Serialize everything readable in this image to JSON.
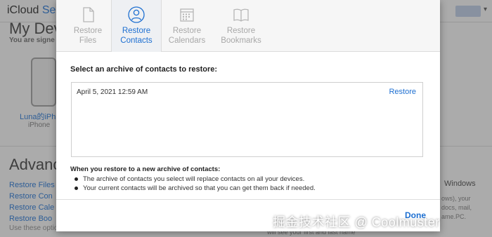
{
  "background": {
    "app_title": "iCloud",
    "app_title_accent": "Se",
    "heading_devices": "My Devi",
    "devices_subtitle": "You are signe",
    "device_name": "Luna的iPh",
    "device_model": "iPhone",
    "heading_advanced": "Advanc",
    "links": [
      "Restore Files",
      "Restore Con",
      "Restore Cale",
      "Restore Boo"
    ],
    "note": "Use these options if you need to",
    "right_title": "Windows",
    "right_text": [
      "ows), your",
      "docs, mail,",
      "ame.PC."
    ],
    "bottom_text": "will see your first and last name"
  },
  "modal": {
    "tabs": [
      {
        "label_line1": "Restore",
        "label_line2": "Files",
        "icon": "file-icon",
        "active": false
      },
      {
        "label_line1": "Restore",
        "label_line2": "Contacts",
        "icon": "contacts-icon",
        "active": true
      },
      {
        "label_line1": "Restore",
        "label_line2": "Calendars",
        "icon": "calendar-icon",
        "active": false
      },
      {
        "label_line1": "Restore",
        "label_line2": "Bookmarks",
        "icon": "bookmarks-icon",
        "active": false
      }
    ],
    "prompt": "Select an archive of contacts to restore:",
    "archives": [
      {
        "date": "April 5, 2021 12:59 AM",
        "action": "Restore"
      }
    ],
    "info_title": "When you restore to a new archive of contacts:",
    "info_items": [
      "The archive of contacts you select will replace contacts on all your devices.",
      "Your current contacts will be archived so that you can get them back if needed."
    ],
    "done_label": "Done"
  },
  "watermark": "掘金技术社区 @ Coolmuster",
  "colors": {
    "accent": "#1d6fd1",
    "inactive_tab": "#a8a8a8",
    "toolbar_bg": "#f6f6f6"
  }
}
